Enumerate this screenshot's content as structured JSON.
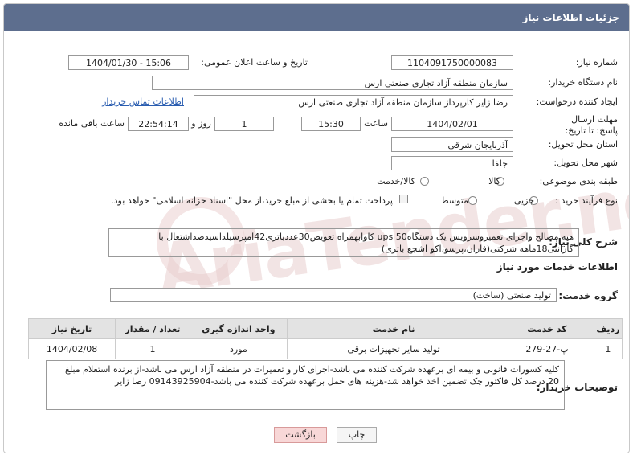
{
  "header": {
    "title": "جزئیات اطلاعات نیاز"
  },
  "fields": {
    "need_number_label": "شماره نیاز:",
    "need_number": "1104091750000083",
    "announce_label": "تاریخ و ساعت اعلان عمومی:",
    "announce_value": "1404/01/30 - 15:06",
    "buyer_org_label": "نام دستگاه خریدار:",
    "buyer_org": "سازمان منطقه آزاد تجاری صنعتی ارس",
    "creator_label": "ایجاد کننده درخواست:",
    "creator": "رضا زایر کارپرداز سازمان منطقه آزاد تجاری صنعتی ارس",
    "contact_link": "اطلاعات تماس خریدار",
    "deadline_label": "مهلت ارسال پاسخ: تا تاریخ:",
    "deadline_date": "1404/02/01",
    "time_label": "ساعت",
    "deadline_time": "15:30",
    "days_value": "1",
    "days_label": "روز و",
    "remaining_time": "22:54:14",
    "remaining_label": "ساعت باقی مانده",
    "province_label": "استان محل تحویل:",
    "province": "آذربایجان شرقی",
    "city_label": "شهر محل تحویل:",
    "city": "جلفا",
    "category_label": "طبقه بندی موضوعی:",
    "category_options": [
      "کالا",
      "کالا/خدمت"
    ],
    "process_label": "نوع فرآیند خرید :",
    "process_options": [
      "جزیی",
      "متوسط"
    ],
    "payment_note": "پرداخت تمام یا بخشی از مبلغ خرید،از محل \"اسناد خزانه اسلامی\" خواهد بود."
  },
  "description": {
    "label": "شرح کلی نیاز:",
    "text": "هیه مصالح واجرای تعمیروسرویس یک دستگاهups 50 کاوابهمراه تعویض30عددباتری42آمپرسیلداسیدضداشتعال با گارانتی18ماهه شرکتی(فاران،پرسو،اکو اشجع باتری)"
  },
  "services": {
    "section_title": "اطلاعات خدمات مورد نیاز",
    "group_label": "گروه خدمت:",
    "group_value": "تولید صنعتی (ساخت)",
    "columns": [
      "ردیف",
      "کد خدمت",
      "نام خدمت",
      "واحد اندازه گیری",
      "تعداد / مقدار",
      "تاریخ نیاز"
    ],
    "rows": [
      [
        "1",
        "پ-27-279",
        "تولید سایر تجهیزات برقی",
        "مورد",
        "1",
        "1404/02/08"
      ]
    ]
  },
  "buyer_notes": {
    "label": "توضیحات خریدار:",
    "text": "کلیه کسورات قانونی و بیمه ای برعهده شرکت کننده می باشد-اجرای کار و تعمیرات در منطقه آزاد ارس می باشد-از برنده استعلام مبلغ 20 درصد کل فاکتور چک تضمین اخذ خواهد شد-هزینه های حمل برعهده شرکت کننده می باشد-09143925904 رضا زایر"
  },
  "buttons": {
    "print": "چاپ",
    "back": "بازگشت"
  },
  "watermark": "AriaTender.net"
}
